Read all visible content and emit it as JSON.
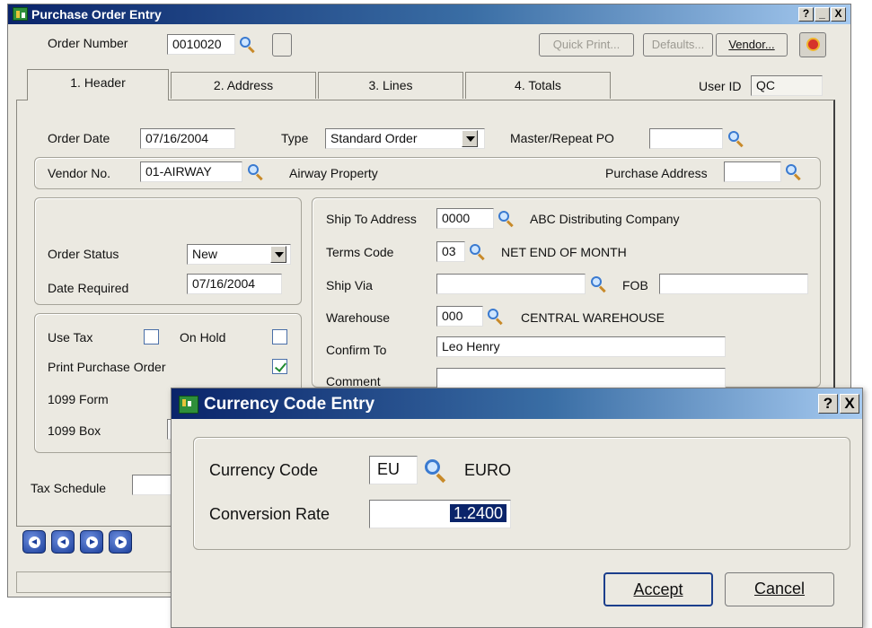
{
  "main_window": {
    "title": "Purchase Order Entry",
    "caption_help": "?",
    "caption_min": "_",
    "caption_max": "□",
    "caption_close": "X",
    "order_number_label": "Order Number",
    "order_number": "0010020",
    "quick_print_label": "Quick Print...",
    "defaults_label": "Defaults...",
    "vendor_button_label": "Vendor...",
    "tabs": [
      {
        "label": "1. Header"
      },
      {
        "label": "2. Address"
      },
      {
        "label": "3. Lines"
      },
      {
        "label": "4. Totals"
      }
    ],
    "user_id_label": "User ID",
    "user_id": "QC",
    "order_date_label": "Order Date",
    "order_date": "07/16/2004",
    "type_label": "Type",
    "type_value": "Standard Order",
    "master_repeat_label": "Master/Repeat PO",
    "master_repeat_value": "",
    "vendor_no_label": "Vendor No.",
    "vendor_no": "01-AIRWAY",
    "vendor_name": "Airway Property",
    "purchase_address_label": "Purchase Address",
    "purchase_address": "",
    "order_status_label": "Order Status",
    "order_status": "New",
    "date_required_label": "Date Required",
    "date_required": "07/16/2004",
    "use_tax_label": "Use Tax",
    "on_hold_label": "On Hold",
    "print_po_label": "Print Purchase Order",
    "form_1099_label": "1099 Form",
    "box_1099_label": "1099 Box",
    "tax_schedule_label": "Tax Schedule",
    "tax_schedule": "",
    "ship_to_address_label": "Ship To Address",
    "ship_to_code": "0000",
    "ship_to_name": "ABC Distributing Company",
    "terms_code_label": "Terms Code",
    "terms_code": "03",
    "terms_desc": "NET END OF MONTH",
    "ship_via_label": "Ship Via",
    "ship_via": "",
    "fob_label": "FOB",
    "fob": "",
    "warehouse_label": "Warehouse",
    "warehouse_code": "000",
    "warehouse_name": "CENTRAL WAREHOUSE",
    "confirm_to_label": "Confirm To",
    "confirm_to": "Leo Henry",
    "comment_label": "Comment",
    "comment": ""
  },
  "checkboxes": {
    "use_tax": false,
    "on_hold": false,
    "print_purchase_order": true
  },
  "dialog": {
    "title": "Currency Code Entry",
    "caption_help": "?",
    "caption_close": "X",
    "currency_code_label": "Currency Code",
    "currency_code": "EU",
    "currency_desc": "EURO",
    "conversion_rate_label": "Conversion Rate",
    "conversion_rate": "1.2400",
    "accept_label": "Accept",
    "cancel_label": "Cancel"
  },
  "colors": {
    "titlebar_start": "#0a246a",
    "titlebar_end": "#a6caf0",
    "selection": "#0a246a",
    "window_bg": "#ebe9e1"
  }
}
